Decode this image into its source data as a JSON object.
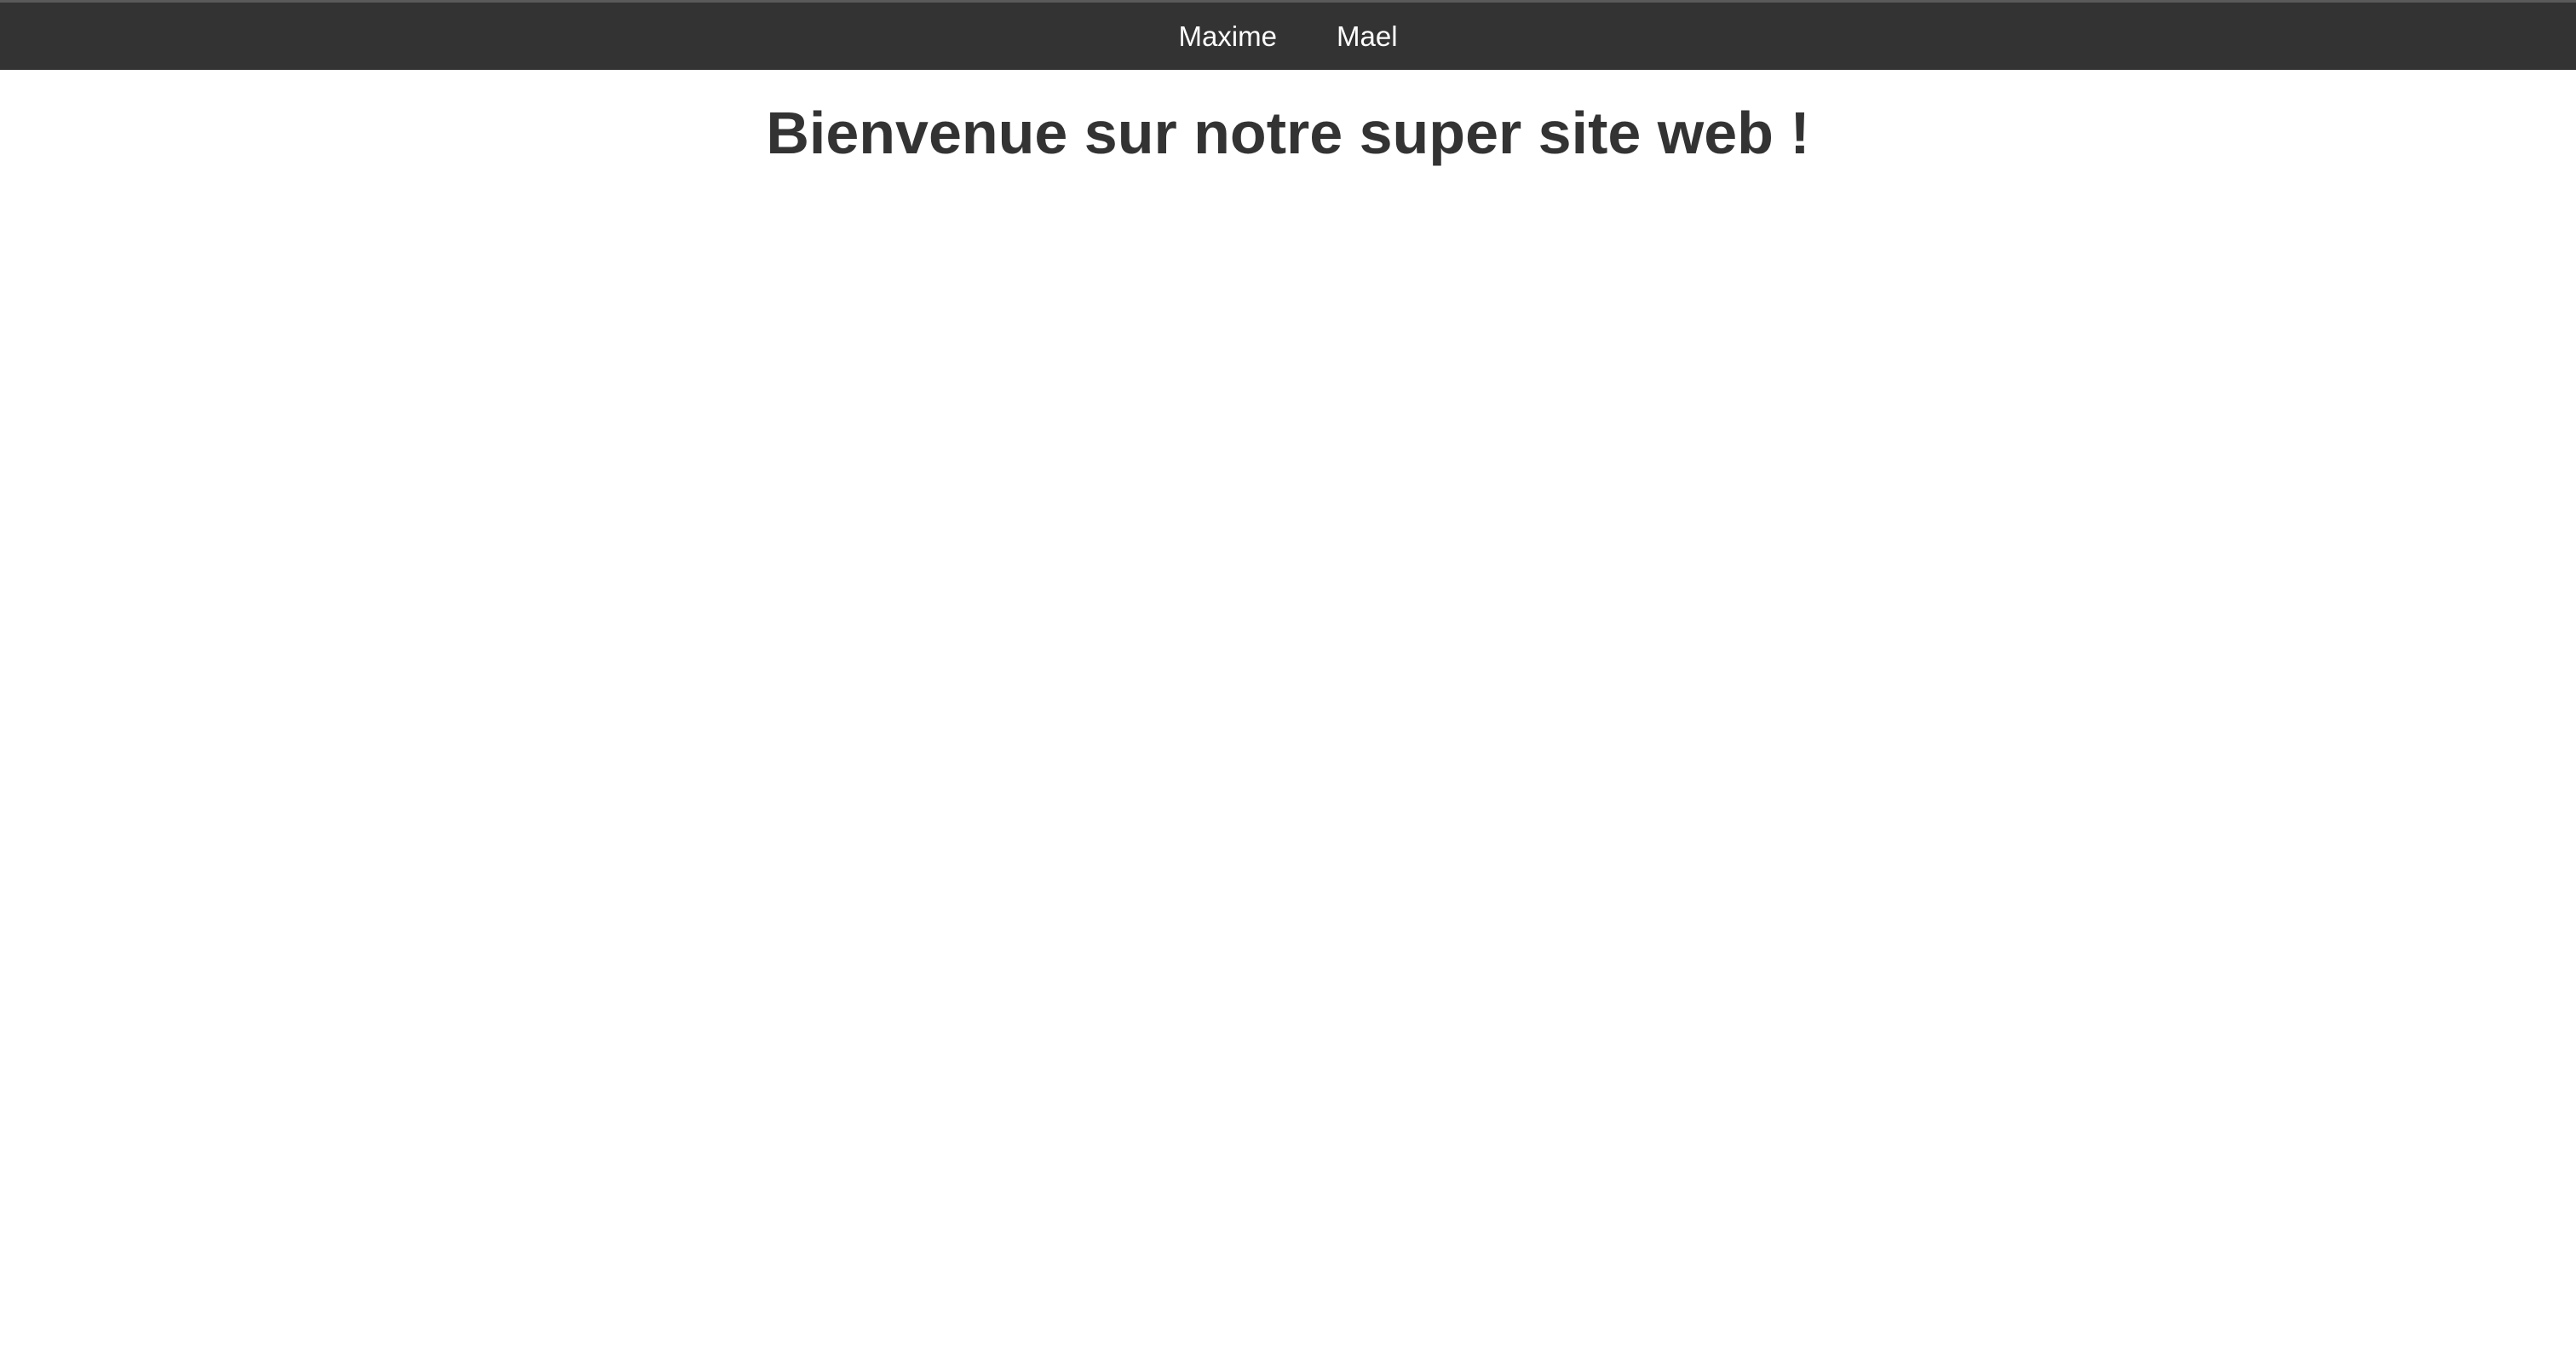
{
  "nav": {
    "items": [
      {
        "label": "Maxime"
      },
      {
        "label": "Mael"
      }
    ]
  },
  "page": {
    "title": "Bienvenue sur notre super site web !"
  },
  "colors": {
    "topbar_bg": "#333333",
    "topbar_border": "#5a5a5a",
    "nav_text": "#ffffff",
    "title_text": "#333333",
    "page_bg": "#ffffff"
  }
}
